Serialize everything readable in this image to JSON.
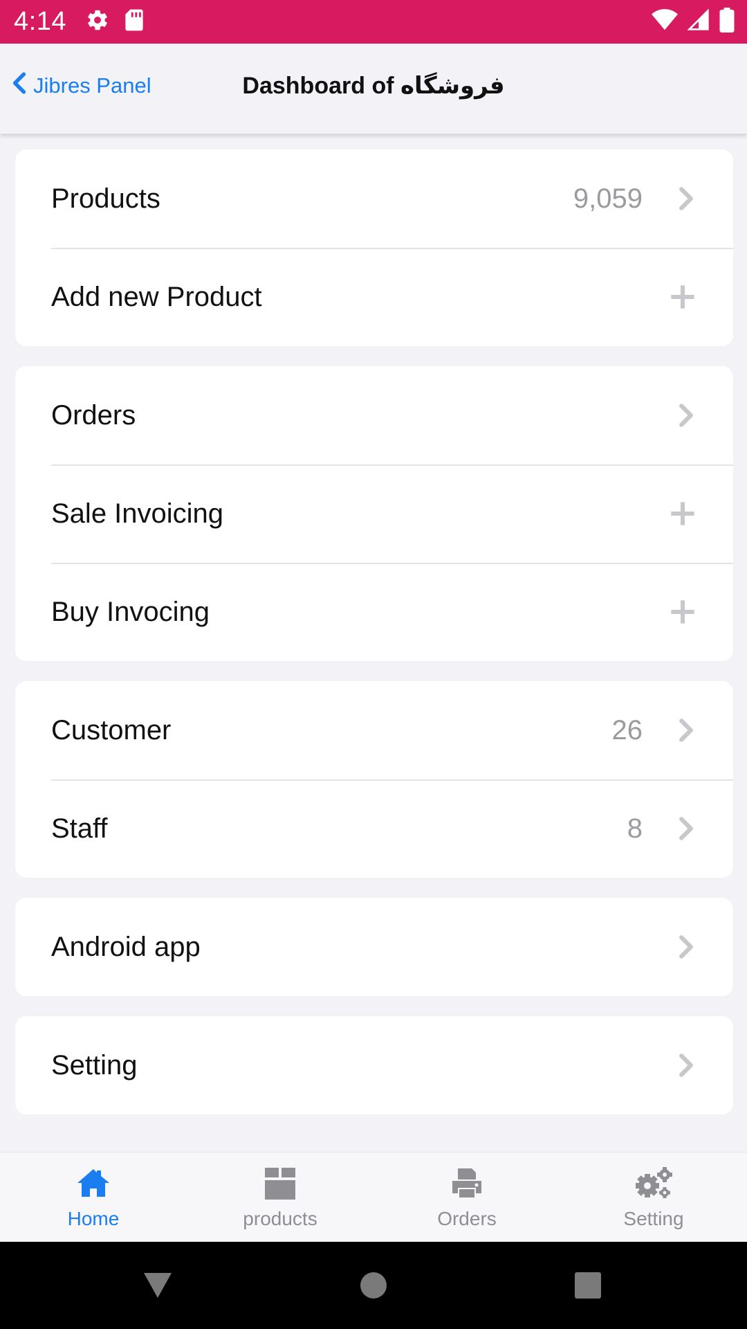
{
  "status_bar": {
    "time": "4:14",
    "icons_left": [
      "gear-icon",
      "sd-card-icon"
    ],
    "icons_right": [
      "wifi-icon",
      "signal-icon",
      "battery-icon"
    ]
  },
  "navbar": {
    "back_label": "Jibres Panel",
    "title": "Dashboard of فروشگاه"
  },
  "menu": {
    "groups": [
      {
        "items": [
          {
            "label": "Products",
            "value": "9,059",
            "icon": "chevron-right-icon"
          },
          {
            "label": "Add new Product",
            "value": "",
            "icon": "plus-icon"
          }
        ]
      },
      {
        "items": [
          {
            "label": "Orders",
            "value": "",
            "icon": "chevron-right-icon"
          },
          {
            "label": "Sale Invoicing",
            "value": "",
            "icon": "plus-icon"
          },
          {
            "label": "Buy Invocing",
            "value": "",
            "icon": "plus-icon"
          }
        ]
      },
      {
        "items": [
          {
            "label": "Customer",
            "value": "26",
            "icon": "chevron-right-icon"
          },
          {
            "label": "Staff",
            "value": "8",
            "icon": "chevron-right-icon"
          }
        ]
      },
      {
        "items": [
          {
            "label": "Android app",
            "value": "",
            "icon": "chevron-right-icon"
          }
        ]
      },
      {
        "items": [
          {
            "label": "Setting",
            "value": "",
            "icon": "chevron-right-icon"
          }
        ]
      }
    ]
  },
  "tabbar": {
    "tabs": [
      {
        "label": "Home",
        "icon": "home-icon",
        "active": true
      },
      {
        "label": "products",
        "icon": "box-icon",
        "active": false
      },
      {
        "label": "Orders",
        "icon": "printer-icon",
        "active": false
      },
      {
        "label": "Setting",
        "icon": "gears-icon",
        "active": false
      }
    ]
  },
  "colors": {
    "status_bar": "#d81b60",
    "accent": "#1a7ef0",
    "background": "#f2f2f7",
    "muted": "#8e8e93"
  }
}
